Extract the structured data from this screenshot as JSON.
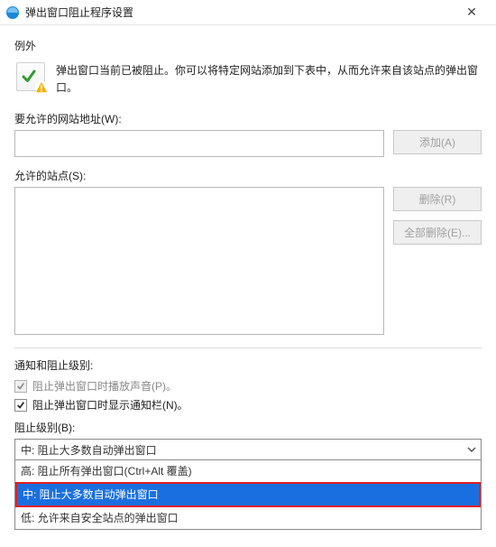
{
  "titlebar": {
    "title": "弹出窗口阻止程序设置"
  },
  "exceptions": {
    "heading": "例外",
    "description": "弹出窗口当前已被阻止。你可以将特定网站添加到下表中，从而允许来自该站点的弹出窗口。"
  },
  "address": {
    "label": "要允许的网站地址(W):",
    "value": "",
    "placeholder": ""
  },
  "buttons": {
    "add": "添加(A)",
    "remove": "删除(R)",
    "remove_all": "全部删除(E)..."
  },
  "allowed_sites": {
    "label": "允许的站点(S):"
  },
  "notifications": {
    "heading": "通知和阻止级别:",
    "play_sound": "阻止弹出窗口时播放声音(P)。",
    "show_bar": "阻止弹出窗口时显示通知栏(N)。",
    "play_sound_checked": true,
    "show_bar_checked": true
  },
  "blocking": {
    "label": "阻止级别(B):",
    "selected": "中: 阻止大多数自动弹出窗口",
    "options": {
      "high": "高: 阻止所有弹出窗口(Ctrl+Alt 覆盖)",
      "medium": "中: 阻止大多数自动弹出窗口",
      "low": "低: 允许来自安全站点的弹出窗口"
    }
  }
}
